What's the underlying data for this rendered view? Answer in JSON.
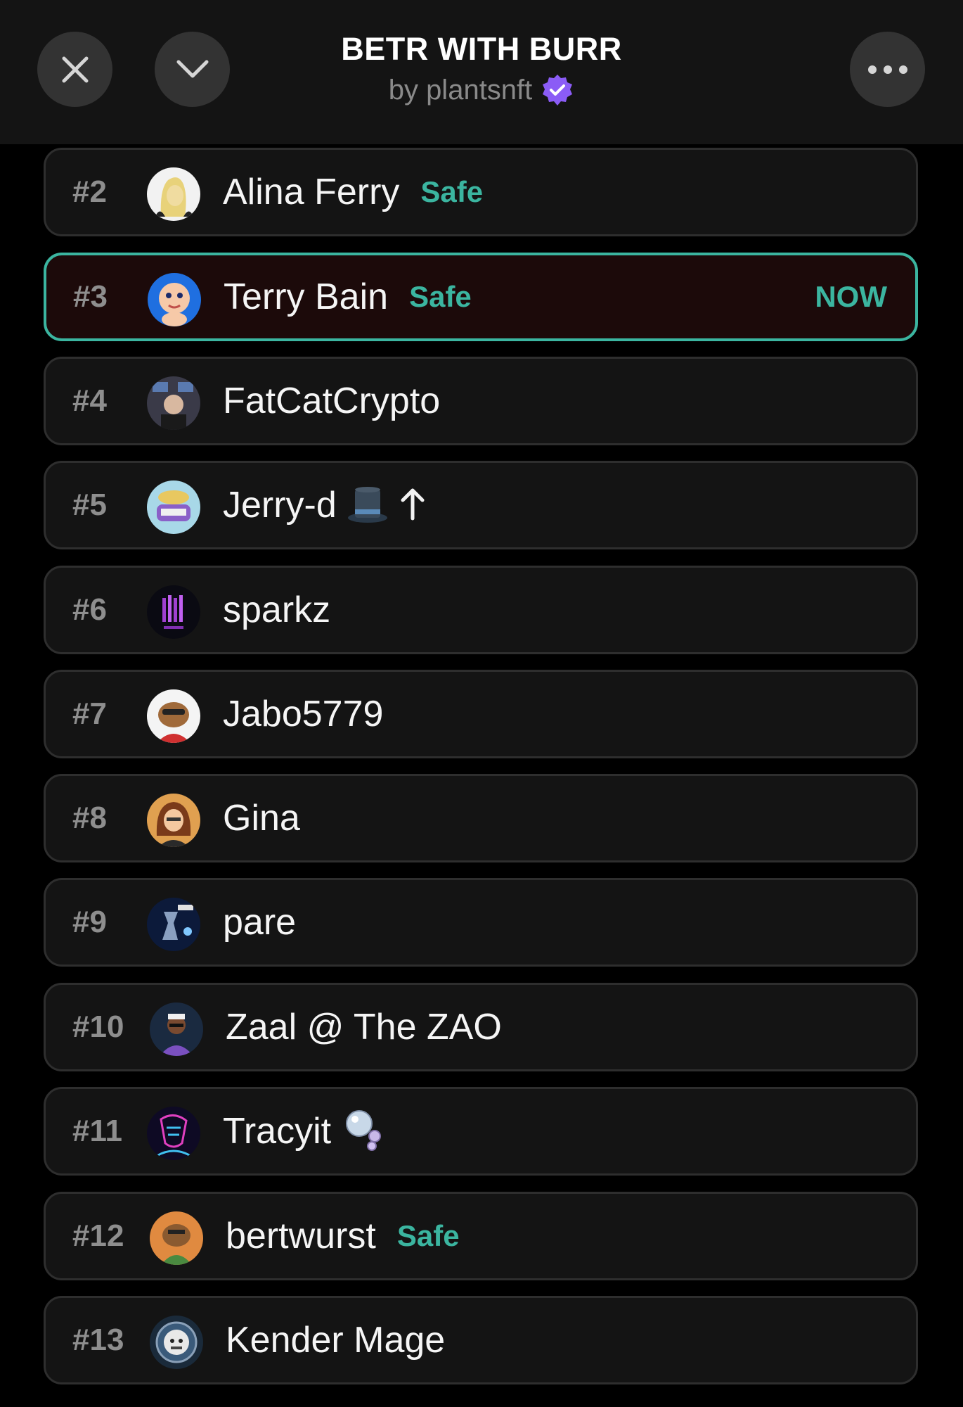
{
  "header": {
    "title": "BETR WITH BURR",
    "subtitle": "by plantsnft",
    "close_icon": "close-icon",
    "collapse_icon": "chevron-down-icon",
    "more_icon": "more-horizontal-icon",
    "verified_icon": "verified-badge-icon",
    "verified_color": "#8b5cf6"
  },
  "colors": {
    "accent": "#3bb5a0",
    "row_bg": "#141414",
    "current_row_bg": "#1c0a0a"
  },
  "rows": [
    {
      "rank": "#2",
      "name": "Alina Ferry",
      "badge": "Safe",
      "now": ""
    },
    {
      "rank": "#3",
      "name": "Terry Bain",
      "badge": "Safe",
      "now": "NOW"
    },
    {
      "rank": "#4",
      "name": "FatCatCrypto",
      "badge": "",
      "now": ""
    },
    {
      "rank": "#5",
      "name": "Jerry-d",
      "badge": "",
      "now": ""
    },
    {
      "rank": "#6",
      "name": "sparkz",
      "badge": "",
      "now": ""
    },
    {
      "rank": "#7",
      "name": "Jabo5779",
      "badge": "",
      "now": ""
    },
    {
      "rank": "#8",
      "name": "Gina",
      "badge": "",
      "now": ""
    },
    {
      "rank": "#9",
      "name": "pare",
      "badge": "",
      "now": ""
    },
    {
      "rank": "#10",
      "name": "Zaal @ The ZAO",
      "badge": "",
      "now": ""
    },
    {
      "rank": "#11",
      "name": "Tracyit",
      "badge": "",
      "now": ""
    },
    {
      "rank": "#12",
      "name": "bertwurst",
      "badge": "Safe",
      "now": ""
    },
    {
      "rank": "#13",
      "name": "Kender Mage",
      "badge": "",
      "now": ""
    }
  ]
}
